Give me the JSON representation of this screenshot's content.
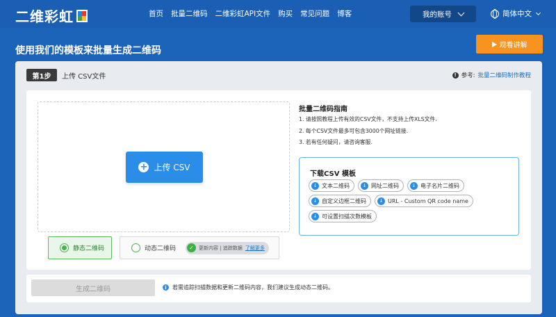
{
  "header": {
    "logo_text": "二维彩虹",
    "nav": [
      "首页",
      "批量二维码",
      "二维彩虹API文件",
      "购买",
      "常见问题",
      "博客"
    ],
    "account_label": "我的账号",
    "language_label": "简体中文"
  },
  "page": {
    "title": "使用我们的模板来批量生成二维码",
    "video_button": "观看讲解"
  },
  "step": {
    "badge": "第1步",
    "label": "上传 CSV文件",
    "ref_prefix": "参考:",
    "ref_link": "批量二维码制作教程"
  },
  "upload": {
    "button_label": "上传 CSV"
  },
  "qr_types": {
    "static_label": "静态二维码",
    "dynamic_label": "动态二维码",
    "dynamic_pill_text": "更新内容 | 追踪数据",
    "learn_more": "了解更多"
  },
  "guide": {
    "title": "批量二维码指南",
    "items": [
      "1. 请按照教程上传有效的CSV文件，不支持上传XLS文件.",
      "2. 每个CSV文件最多可包含3000个网址链接.",
      "3. 若有任何疑问，请咨询客服."
    ]
  },
  "templates": {
    "title": "下载CSV 模板",
    "items": [
      "文本二维码",
      "网址二维码",
      "电子名片二维码",
      "自定义边框二维码",
      "URL - Custom QR code name",
      "可设置扫描次数模板"
    ]
  },
  "footer": {
    "generate_label": "生成二维码",
    "hint": "若需追踪扫描数据和更新二维码内容，我们建议生成动态二维码。"
  },
  "colors": {
    "brand_blue": "#1a5fb4",
    "accent_orange": "#f7931e",
    "upload_blue": "#2a8de8",
    "static_green": "#4caf50"
  }
}
